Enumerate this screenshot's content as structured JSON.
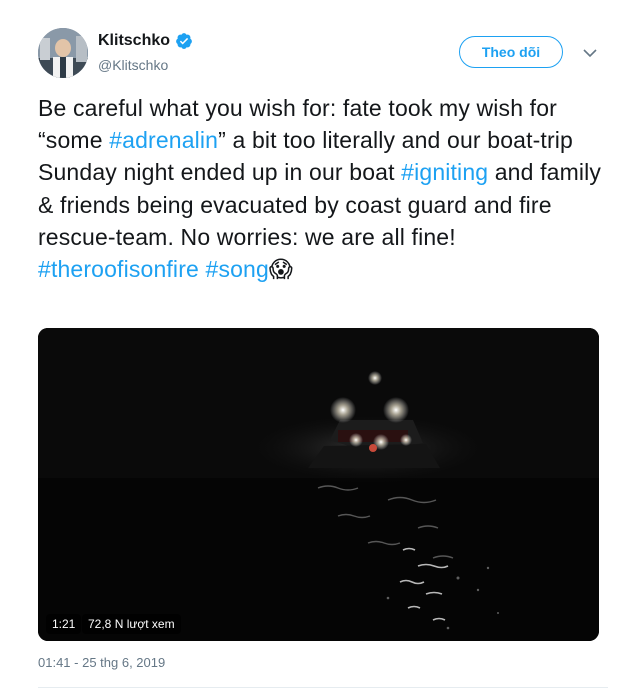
{
  "author": {
    "name": "Klitschko",
    "handle": "@Klitschko",
    "verified_icon": "verified-badge-icon"
  },
  "follow_button": {
    "label": "Theo dõi"
  },
  "tweet": {
    "parts": [
      {
        "text": "Be careful what you wish for: fate took my wish for “some ",
        "hashtag": false
      },
      {
        "text": "#adrenalin",
        "hashtag": true
      },
      {
        "text": "” a bit too literally and our boat-trip Sunday night ended up in our boat ",
        "hashtag": false
      },
      {
        "text": "#igniting",
        "hashtag": true
      },
      {
        "text": " and family & friends being evacuated by coast guard and fire rescue-team. No worries: we are all fine! ",
        "hashtag": false
      },
      {
        "text": "#theroofisonfire",
        "hashtag": true
      },
      {
        "text": " ",
        "hashtag": false
      },
      {
        "text": "#song",
        "hashtag": true
      }
    ],
    "emoji": "😱"
  },
  "video": {
    "duration": "1:21",
    "views": "72,8 N lượt xem"
  },
  "timestamp": "01:41 - 25 thg 6, 2019",
  "colors": {
    "accent": "#1da1f2",
    "text": "#14171a",
    "muted": "#657786"
  }
}
